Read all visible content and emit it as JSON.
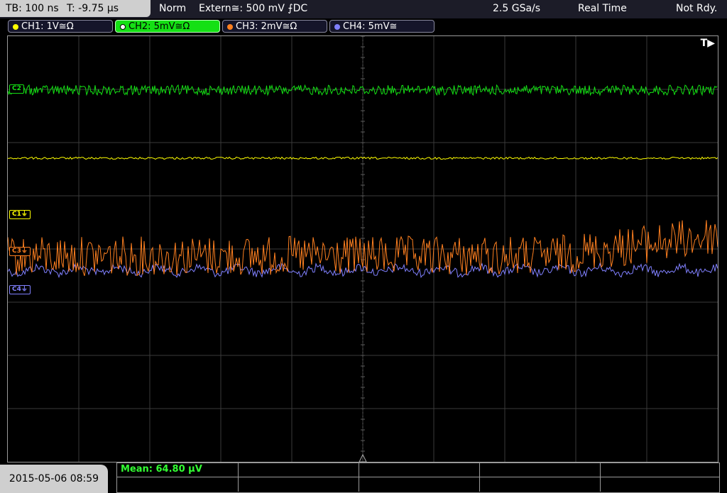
{
  "timebase": {
    "tb": "TB: 100 ns",
    "t": "T: -9.75 µs"
  },
  "status": {
    "mode": "Norm",
    "trigger": "Extern≅: 500 mV ⨍DC",
    "sample_rate": "2.5 GSa/s",
    "acq": "Real Time",
    "ready": "Not Rdy."
  },
  "channels": [
    {
      "id": "ch1",
      "label": "CH1: 1V≅Ω",
      "color": "#ffff00",
      "active": false
    },
    {
      "id": "ch2",
      "label": "CH2: 5mV≅Ω",
      "color": "#14e014",
      "active": true
    },
    {
      "id": "ch3",
      "label": "CH3: 2mV≅Ω",
      "color": "#ff8020",
      "active": false
    },
    {
      "id": "ch4",
      "label": "CH4: 5mV≅",
      "color": "#8080ff",
      "active": false
    }
  ],
  "markers": {
    "c1": "C1⏚",
    "c3": "C3⏚",
    "c4": "C4⏚",
    "c2": "C2"
  },
  "trigger_icon": "T▶",
  "datetime": "2015-05-06 08:59",
  "measurement": {
    "mean": "Mean: 64.80 µV"
  }
}
